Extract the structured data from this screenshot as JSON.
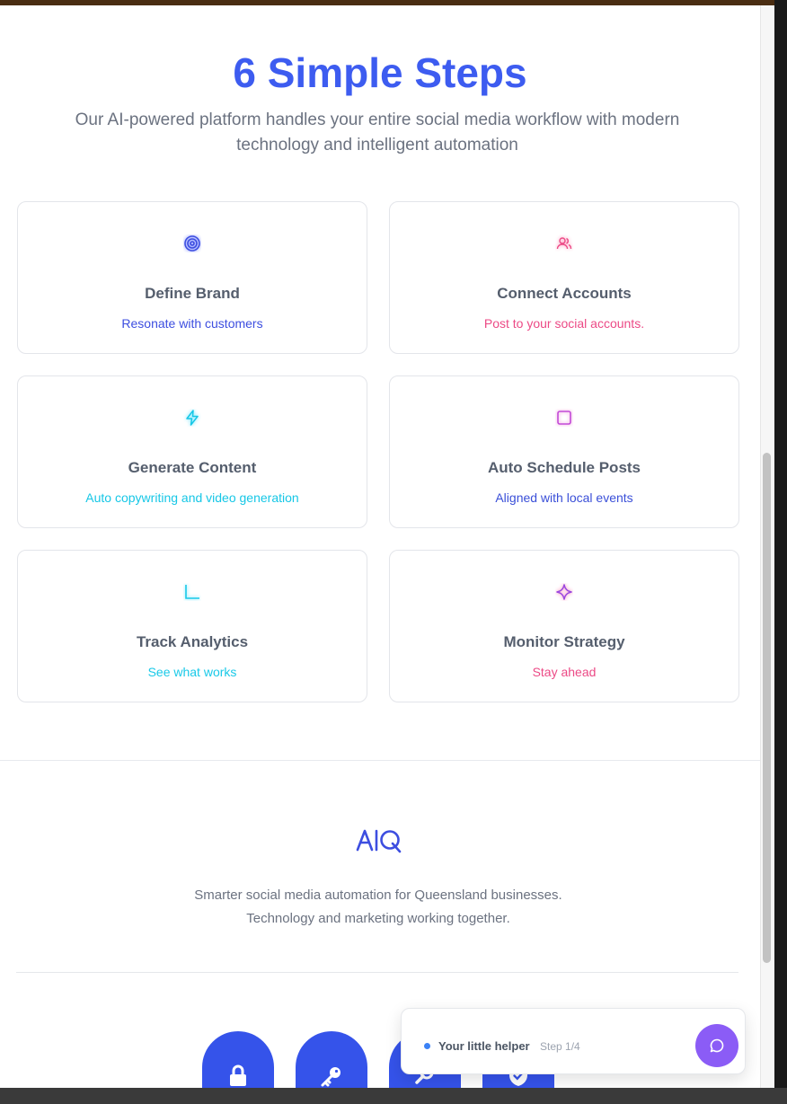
{
  "section": {
    "title": "6 Simple Steps",
    "subtitle": "Our AI-powered platform handles your entire social media workflow with modern technology and intelligent automation"
  },
  "steps": [
    {
      "title": "Define Brand",
      "subtitle": "Resonate with customers",
      "icon": "target-icon",
      "color": "#3d4ee0"
    },
    {
      "title": "Connect Accounts",
      "subtitle": "Post to your social accounts.",
      "icon": "users-icon",
      "color": "#ec4a86"
    },
    {
      "title": "Generate Content",
      "subtitle": "Auto copywriting and video generation",
      "icon": "lightning-icon",
      "color": "#16c7e6"
    },
    {
      "title": "Auto Schedule Posts",
      "subtitle": "Aligned with local events",
      "icon": "square-icon",
      "color": "#3a4fd8"
    },
    {
      "title": "Track Analytics",
      "subtitle": "See what works",
      "icon": "chart-axis-icon",
      "color": "#19c9e8"
    },
    {
      "title": "Monitor Strategy",
      "subtitle": "Stay ahead",
      "icon": "sparkle-icon",
      "color": "#ec4a86"
    }
  ],
  "footer": {
    "logo_text": "AIQ",
    "tagline_line1": "Smarter social media automation for Queensland businesses.",
    "tagline_line2": "Technology and marketing working together.",
    "badges": [
      "lock-icon",
      "key-icon",
      "search-icon",
      "shield-icon"
    ]
  },
  "helper": {
    "label": "Your little helper",
    "step": "Step 1/4",
    "button_icon": "chat-bubble-icon"
  },
  "colors": {
    "brand_blue": "#3d5cf0",
    "badge_blue": "#3553ea",
    "helper_purple": "#8b5cf6"
  }
}
